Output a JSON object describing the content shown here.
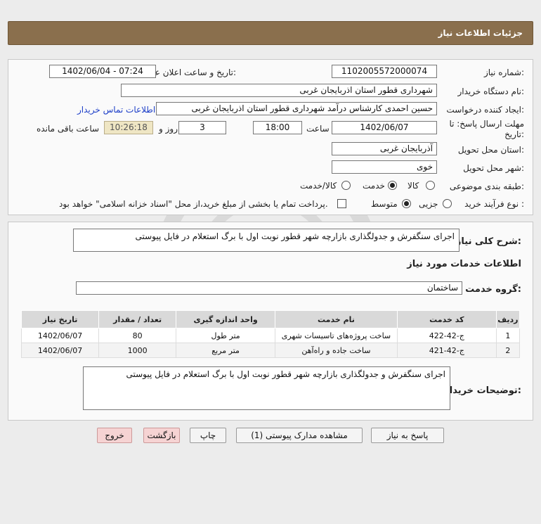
{
  "header": {
    "title": "جزئیات اطلاعات نیاز"
  },
  "fields": {
    "need_number_label": "شماره نیاز:",
    "need_number": "1102005572000074",
    "announce_label": "تاریخ و ساعت اعلان عمومی:",
    "announce_value": "1402/06/04 - 07:24",
    "buyer_org_label": "نام دستگاه خریدار:",
    "buyer_org": "شهرداری قطور استان اذربایجان غربی",
    "creator_label": "ایجاد کننده درخواست:",
    "creator": "حسین احمدی کارشناس درآمد شهرداری قطور استان اذربایجان غربی",
    "contact_link": "اطلاعات تماس خریدار",
    "deadline_label_1": "مهلت ارسال پاسخ: تا",
    "deadline_label_2": "تاریخ:",
    "deadline_date": "1402/06/07",
    "time_label": "ساعت",
    "deadline_time": "18:00",
    "days": "3",
    "days_label": "روز و",
    "remaining_time": "10:26:18",
    "remaining_label": "ساعت باقی مانده",
    "province_label": "استان محل تحویل:",
    "province": "آذربایجان غربی",
    "city_label": "شهر محل تحویل:",
    "city": "خوی",
    "category_label": "طبقه بندی موضوعی:",
    "category_options": [
      "کالا",
      "خدمت",
      "کالا/خدمت"
    ],
    "category_selected": "خدمت",
    "purchase_type_label": "نوع فرآیند خرید :",
    "purchase_options": [
      "جزیی",
      "متوسط"
    ],
    "purchase_selected": "متوسط",
    "payment_note": "پرداخت تمام یا بخشی از مبلغ خرید،از محل \"اسناد خزانه اسلامی\" خواهد بود."
  },
  "details": {
    "summary_label": "شرح کلی نیاز:",
    "summary": "اجرای سنگفرش و جدولگذاری بازارچه شهر قطور نوبت اول با برگ استعلام در فایل پیوستی",
    "services_title": "اطلاعات خدمات مورد نیاز",
    "service_group_label": "گروه خدمت:",
    "service_group": "ساختمان",
    "table_headers": [
      "ردیف",
      "کد خدمت",
      "نام خدمت",
      "واحد اندازه گیری",
      "تعداد / مقدار",
      "تاریخ نیاز"
    ],
    "rows": [
      {
        "idx": "1",
        "code": "ج-42-422",
        "name": "ساخت پروژه‌های تاسیسات شهری",
        "unit": "متر طول",
        "qty": "80",
        "date": "1402/06/07"
      },
      {
        "idx": "2",
        "code": "ج-42-421",
        "name": "ساخت جاده و راه‌آهن",
        "unit": "متر مربع",
        "qty": "1000",
        "date": "1402/06/07"
      }
    ],
    "buyer_notes_label": "توضیحات خریدار:",
    "buyer_notes": "اجرای سنگفرش و جدولگذاری بازارچه شهر قطور نوبت اول با برگ استعلام در فایل پیوستی"
  },
  "buttons": {
    "respond": "پاسخ به نیاز",
    "attachments": "مشاهده مدارک پیوستی (1)",
    "print": "چاپ",
    "back": "بازگشت",
    "exit": "خروج"
  }
}
